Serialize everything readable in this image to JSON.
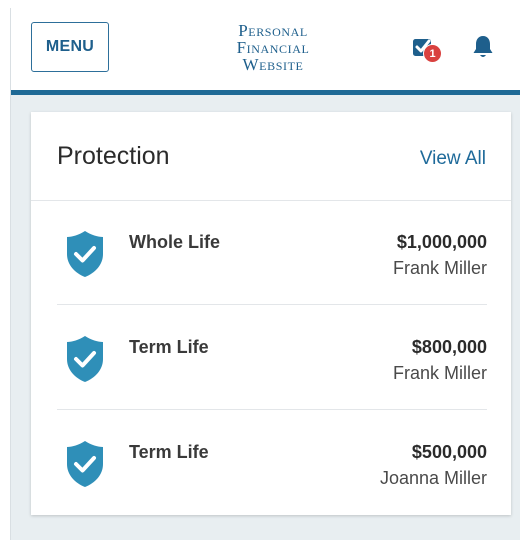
{
  "header": {
    "menu_label": "MENU",
    "logo_lines": [
      "Personal",
      "Financial",
      "Website"
    ],
    "tasks_badge_count": "1"
  },
  "protection": {
    "title": "Protection",
    "view_all_label": "View All",
    "policies": [
      {
        "type": "Whole Life",
        "amount": "$1,000,000",
        "owner": "Frank Miller"
      },
      {
        "type": "Term Life",
        "amount": "$800,000",
        "owner": "Frank Miller"
      },
      {
        "type": "Term Life",
        "amount": "$500,000",
        "owner": "Joanna Miller"
      }
    ]
  },
  "colors": {
    "brand_blue": "#1f6a96",
    "shield_blue": "#2f8fb8",
    "badge_red": "#d9413f",
    "page_background": "#e8eef1"
  }
}
